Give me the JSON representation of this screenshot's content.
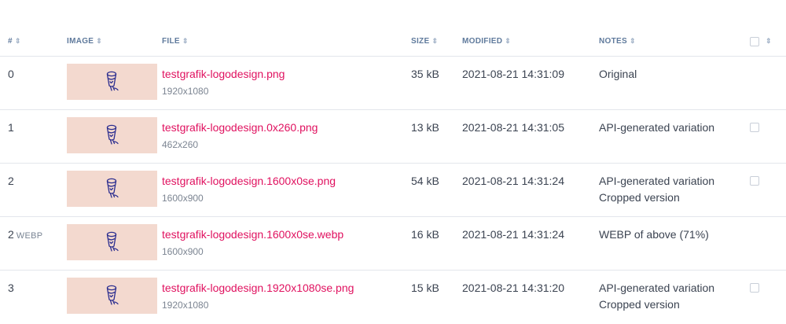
{
  "header": {
    "index": "#",
    "image": "IMAGE",
    "file": "FILE",
    "size": "SIZE",
    "modified": "MODIFIED",
    "notes": "NOTES",
    "sort_glyph": "⇕"
  },
  "colors": {
    "link": "#e0115f",
    "thumb_bg": "#f3d9cf",
    "header_text": "#5f7a9c",
    "logo_stroke": "#2b2d8f"
  },
  "thumb_icon": "pencil-logo-icon",
  "rows": [
    {
      "index": "0",
      "format": "",
      "file": "testgrafik-logodesign.png",
      "dims": "1920x1080",
      "size": "35 kB",
      "modified": "2021-08-21 14:31:09",
      "note1": "Original",
      "note2": "",
      "checkbox": false
    },
    {
      "index": "1",
      "format": "",
      "file": "testgrafik-logodesign.0x260.png",
      "dims": "462x260",
      "size": "13 kB",
      "modified": "2021-08-21 14:31:05",
      "note1": "API-generated variation",
      "note2": "",
      "checkbox": true
    },
    {
      "index": "2",
      "format": "",
      "file": "testgrafik-logodesign.1600x0se.png",
      "dims": "1600x900",
      "size": "54 kB",
      "modified": "2021-08-21 14:31:24",
      "note1": "API-generated variation",
      "note2": "Cropped version",
      "checkbox": true
    },
    {
      "index": "2",
      "format": "WEBP",
      "file": "testgrafik-logodesign.1600x0se.webp",
      "dims": "1600x900",
      "size": "16 kB",
      "modified": "2021-08-21 14:31:24",
      "note1": "WEBP of above (71%)",
      "note2": "",
      "checkbox": false
    },
    {
      "index": "3",
      "format": "",
      "file": "testgrafik-logodesign.1920x1080se.png",
      "dims": "1920x1080",
      "size": "15 kB",
      "modified": "2021-08-21 14:31:20",
      "note1": "API-generated variation",
      "note2": "Cropped version",
      "checkbox": true
    }
  ]
}
